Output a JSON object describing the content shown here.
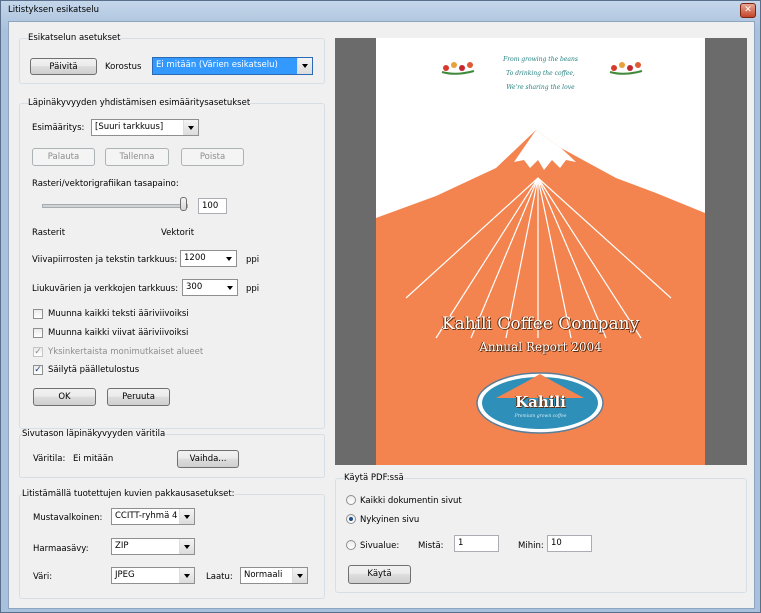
{
  "window": {
    "title": "Litistyksen esikatselu",
    "close_glyph": "✕"
  },
  "preview_settings": {
    "title": "Esikatselun asetukset",
    "refresh_button": "Päivitä",
    "highlight_label": "Korostus",
    "highlight_value": "Ei mitään (Värien esikatselu)"
  },
  "presets": {
    "title": "Läpinäkyvyyden yhdistämisen esimääritysasetukset",
    "preset_label": "Esimääritys:",
    "preset_value": "[Suuri tarkkuus]",
    "reset_button": "Palauta",
    "save_button": "Tallenna",
    "delete_button": "Poista",
    "balance_label": "Rasteri/vektorigrafiikan tasapaino:",
    "balance_value": "100",
    "balance_level": 100,
    "raster_label": "Rasterit",
    "vector_label": "Vektorit",
    "line_art_label": "Viivapiirrosten ja tekstin tarkkuus:",
    "line_art_value": "1200",
    "ppi_label_1": "ppi",
    "gradient_label": "Liukuvärien ja verkkojen tarkkuus:",
    "gradient_value": "300",
    "ppi_label_2": "ppi",
    "convert_text_label": "Muunna kaikki teksti ääriviivoiksi",
    "convert_strokes_label": "Muunna kaikki viivat ääriviivoiksi",
    "simplify_label": "Yksinkertaista monimutkaiset alueet",
    "overprint_label": "Säilytä päälletulostus",
    "ok_button": "OK",
    "cancel_button": "Peruuta"
  },
  "blending": {
    "title": "Sivutason läpinäkyvyyden väritila",
    "colorspace_label": "Väritila:",
    "colorspace_value": "Ei mitään",
    "change_button": "Vaihda..."
  },
  "compression": {
    "title": "Litistämällä tuotettujen kuvien pakkausasetukset:",
    "mono_label": "Mustavalkoinen:",
    "mono_value": "CCITT-ryhmä 4",
    "gray_label": "Harmaasävy:",
    "gray_value": "ZIP",
    "color_label": "Väri:",
    "color_value": "JPEG",
    "quality_label": "Laatu:",
    "quality_value": "Normaali"
  },
  "apply": {
    "title": "Käytä PDF:ssä",
    "all_pages_label": "Kaikki dokumentin sivut",
    "current_page_label": "Nykyinen sivu",
    "page_range_label": "Sivualue:",
    "from_label": "Mistä:",
    "from_value": "1",
    "to_label": "Mihin:",
    "to_value": "10",
    "apply_button": "Käytä"
  },
  "document": {
    "tagline_1": "From growing the beans",
    "tagline_2": "To drinking the coffee,",
    "tagline_3": "We're sharing the love",
    "company": "Kahili Coffee Company",
    "report": "Annual Report 2004",
    "logo_text": "Kahili",
    "logo_subtext": "Premium grown coffee",
    "colors": {
      "orange": "#f4844f",
      "snow": "#ffffff",
      "oval_blue": "#2e8fb8"
    }
  }
}
